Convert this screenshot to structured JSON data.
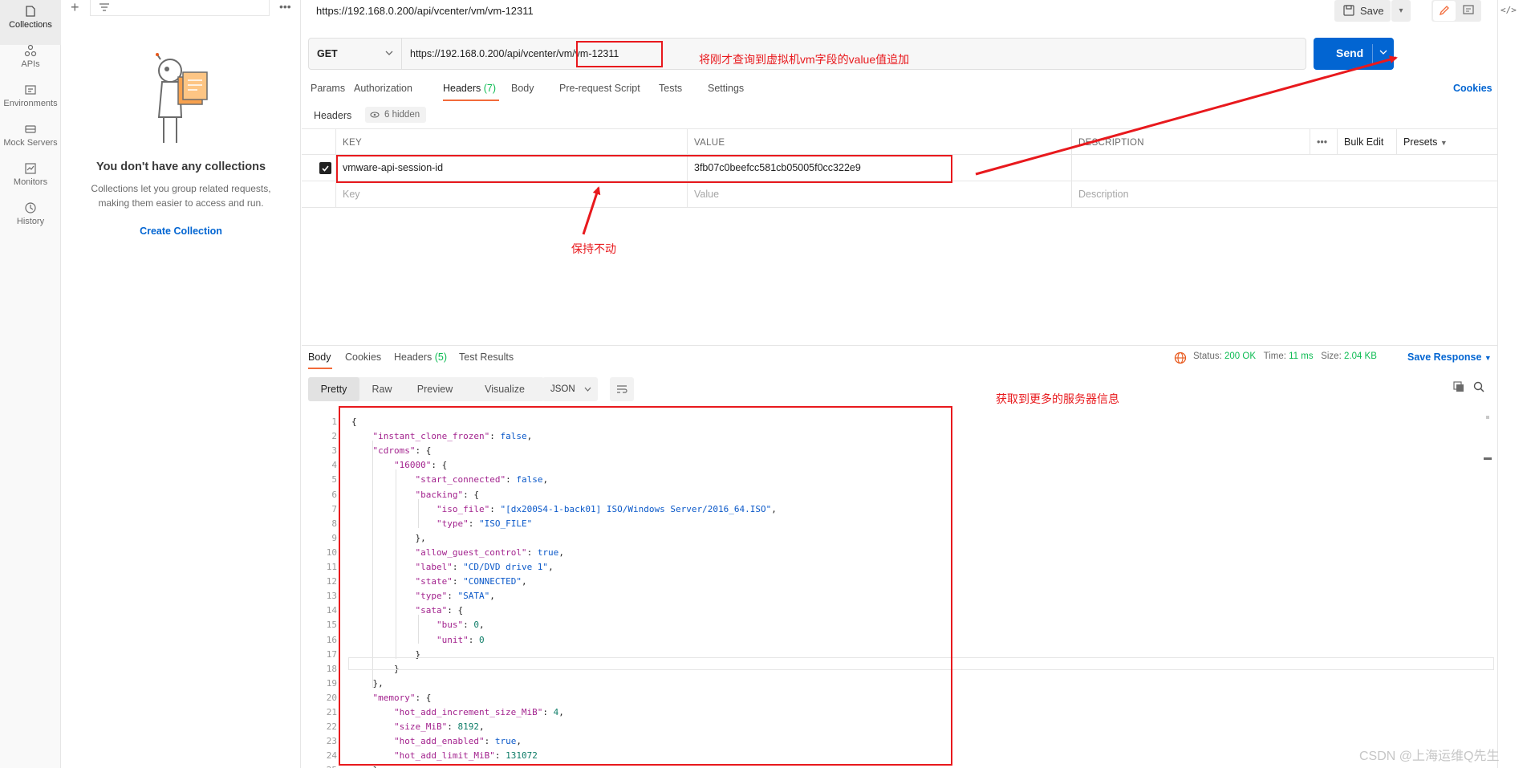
{
  "rail": {
    "items": [
      {
        "label": "Collections",
        "icon": "collections-icon"
      },
      {
        "label": "APIs",
        "icon": "apis-icon"
      },
      {
        "label": "Environments",
        "icon": "environments-icon"
      },
      {
        "label": "Mock Servers",
        "icon": "mock-servers-icon"
      },
      {
        "label": "Monitors",
        "icon": "monitors-icon"
      },
      {
        "label": "History",
        "icon": "history-icon"
      }
    ]
  },
  "sidebar": {
    "empty_title": "You don't have any collections",
    "empty_desc_1": "Collections let you group related requests,",
    "empty_desc_2": "making them easier to access and run.",
    "create_link": "Create Collection"
  },
  "header": {
    "tab_title": "https://192.168.0.200/api/vcenter/vm/vm-12311",
    "save_label": "Save"
  },
  "request": {
    "method": "GET",
    "url": "https://192.168.0.200/api/vcenter/vm/vm-12311",
    "send_label": "Send",
    "tabs": [
      {
        "label": "Params",
        "count": ""
      },
      {
        "label": "Authorization",
        "count": ""
      },
      {
        "label": "Headers",
        "count": "(7)"
      },
      {
        "label": "Body",
        "count": ""
      },
      {
        "label": "Pre-request Script",
        "count": ""
      },
      {
        "label": "Tests",
        "count": ""
      },
      {
        "label": "Settings",
        "count": ""
      }
    ],
    "cookies_label": "Cookies",
    "headers_label": "Headers",
    "hidden_label": "6 hidden"
  },
  "headers_table": {
    "columns": {
      "key": "KEY",
      "value": "VALUE",
      "description": "DESCRIPTION"
    },
    "bulk_edit": "Bulk Edit",
    "presets": "Presets",
    "rows": [
      {
        "checked": true,
        "key": "vmware-api-session-id",
        "value": "3fb07c0beefcc581cb05005f0cc322e9",
        "description": ""
      }
    ],
    "placeholders": {
      "key": "Key",
      "value": "Value",
      "description": "Description"
    }
  },
  "response": {
    "tabs": [
      {
        "label": "Body",
        "count": ""
      },
      {
        "label": "Cookies",
        "count": ""
      },
      {
        "label": "Headers",
        "count": "(5)"
      },
      {
        "label": "Test Results",
        "count": ""
      }
    ],
    "status_label": "Status:",
    "status_value": "200 OK",
    "time_label": "Time:",
    "time_value": "11 ms",
    "size_label": "Size:",
    "size_value": "2.04 KB",
    "save_response": "Save Response",
    "views": [
      "Pretty",
      "Raw",
      "Preview",
      "Visualize"
    ],
    "active_view": "Pretty",
    "format": "JSON"
  },
  "code_lines": [
    "{",
    "    \"instant_clone_frozen\": false,",
    "    \"cdroms\": {",
    "        \"16000\": {",
    "            \"start_connected\": false,",
    "            \"backing\": {",
    "                \"iso_file\": \"[dx200S4-1-back01] ISO/Windows Server/2016_64.ISO\",",
    "                \"type\": \"ISO_FILE\"",
    "            },",
    "            \"allow_guest_control\": true,",
    "            \"label\": \"CD/DVD drive 1\",",
    "            \"state\": \"CONNECTED\",",
    "            \"type\": \"SATA\",",
    "            \"sata\": {",
    "                \"bus\": 0,",
    "                \"unit\": 0",
    "            }",
    "        }",
    "    },",
    "    \"memory\": {",
    "        \"hot_add_increment_size_MiB\": 4,",
    "        \"size_MiB\": 8192,",
    "        \"hot_add_enabled\": true,",
    "        \"hot_add_limit_MiB\": 131072",
    "    },"
  ],
  "annotations": {
    "url_note": "将刚才查询到虚拟机vm字段的value值追加",
    "keep_note": "保持不动",
    "result_note": "获取到更多的服务器信息"
  },
  "watermark": "CSDN @上海运维Q先生",
  "colors": {
    "accent": "#0265d2",
    "tab_indicator": "#f26b3a",
    "ok": "#0cbb52",
    "annotation": "#e8191d"
  }
}
